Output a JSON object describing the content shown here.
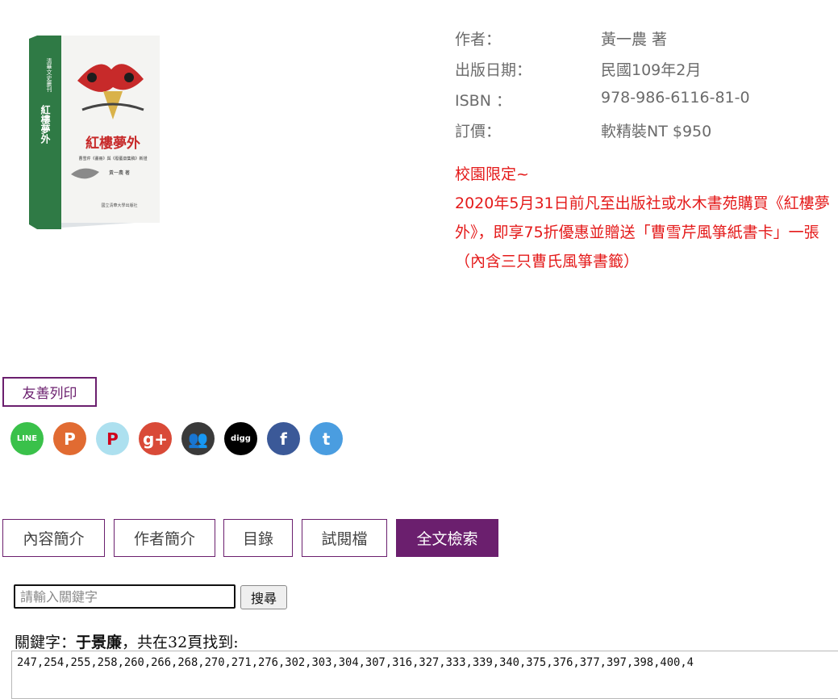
{
  "book": {
    "cover_title": "紅樓夢外",
    "cover_subtitle": "曹雪芹《畫冊》與《廢藝齋集稿》新證",
    "cover_author": "黃一農 著",
    "cover_series": "清華文史叢刊",
    "cover_publisher": "國立清華大學出版社"
  },
  "info": {
    "author_label": "作者：",
    "author_value": "黃一農 著",
    "date_label": "出版日期：",
    "date_value": "民國109年2月",
    "isbn_label": "ISBN ：",
    "isbn_value": "978-986-6116-81-0",
    "price_label": "訂價：",
    "price_value": "軟精裝NT $950"
  },
  "promo": {
    "line1": "校園限定~",
    "body": "2020年5月31日前凡至出版社或水木書苑購買《紅樓夢外》，即享75折優惠並贈送「曹雪芹風箏紙書卡」一張（內含三只曹氏風箏書籤）"
  },
  "print_label": "友善列印",
  "share": [
    {
      "name": "line-icon",
      "color": "#3ac14a",
      "glyph": "LINE"
    },
    {
      "name": "plurk-icon",
      "color": "#e16b32",
      "glyph": "P"
    },
    {
      "name": "pinterest-icon",
      "color": "#ade0ef",
      "glyph": "P"
    },
    {
      "name": "google-plus-icon",
      "color": "#d94a38",
      "glyph": "g+"
    },
    {
      "name": "group-icon",
      "color": "#3a3a3a",
      "glyph": "👥"
    },
    {
      "name": "digg-icon",
      "color": "#000000",
      "glyph": "digg"
    },
    {
      "name": "facebook-icon",
      "color": "#3b5998",
      "glyph": "f"
    },
    {
      "name": "twitter-icon",
      "color": "#4a9de0",
      "glyph": "t"
    }
  ],
  "tabs": [
    {
      "label": "內容簡介",
      "active": false
    },
    {
      "label": "作者簡介",
      "active": false
    },
    {
      "label": "目錄",
      "active": false
    },
    {
      "label": "試閱檔",
      "active": false
    },
    {
      "label": "全文檢索",
      "active": true
    }
  ],
  "search": {
    "placeholder": "請輸入關鍵字",
    "button": "搜尋"
  },
  "result": {
    "prefix": "關鍵字：",
    "keyword": "于景廉",
    "suffix": "，共在32頁找到:",
    "pages": "247,254,255,258,260,266,268,270,271,276,302,303,304,307,316,327,333,339,340,375,376,377,397,398,400,4"
  },
  "colors": {
    "accent": "#6b1f6e",
    "promo": "#e41a1a",
    "info_text": "#6b6b6b"
  }
}
